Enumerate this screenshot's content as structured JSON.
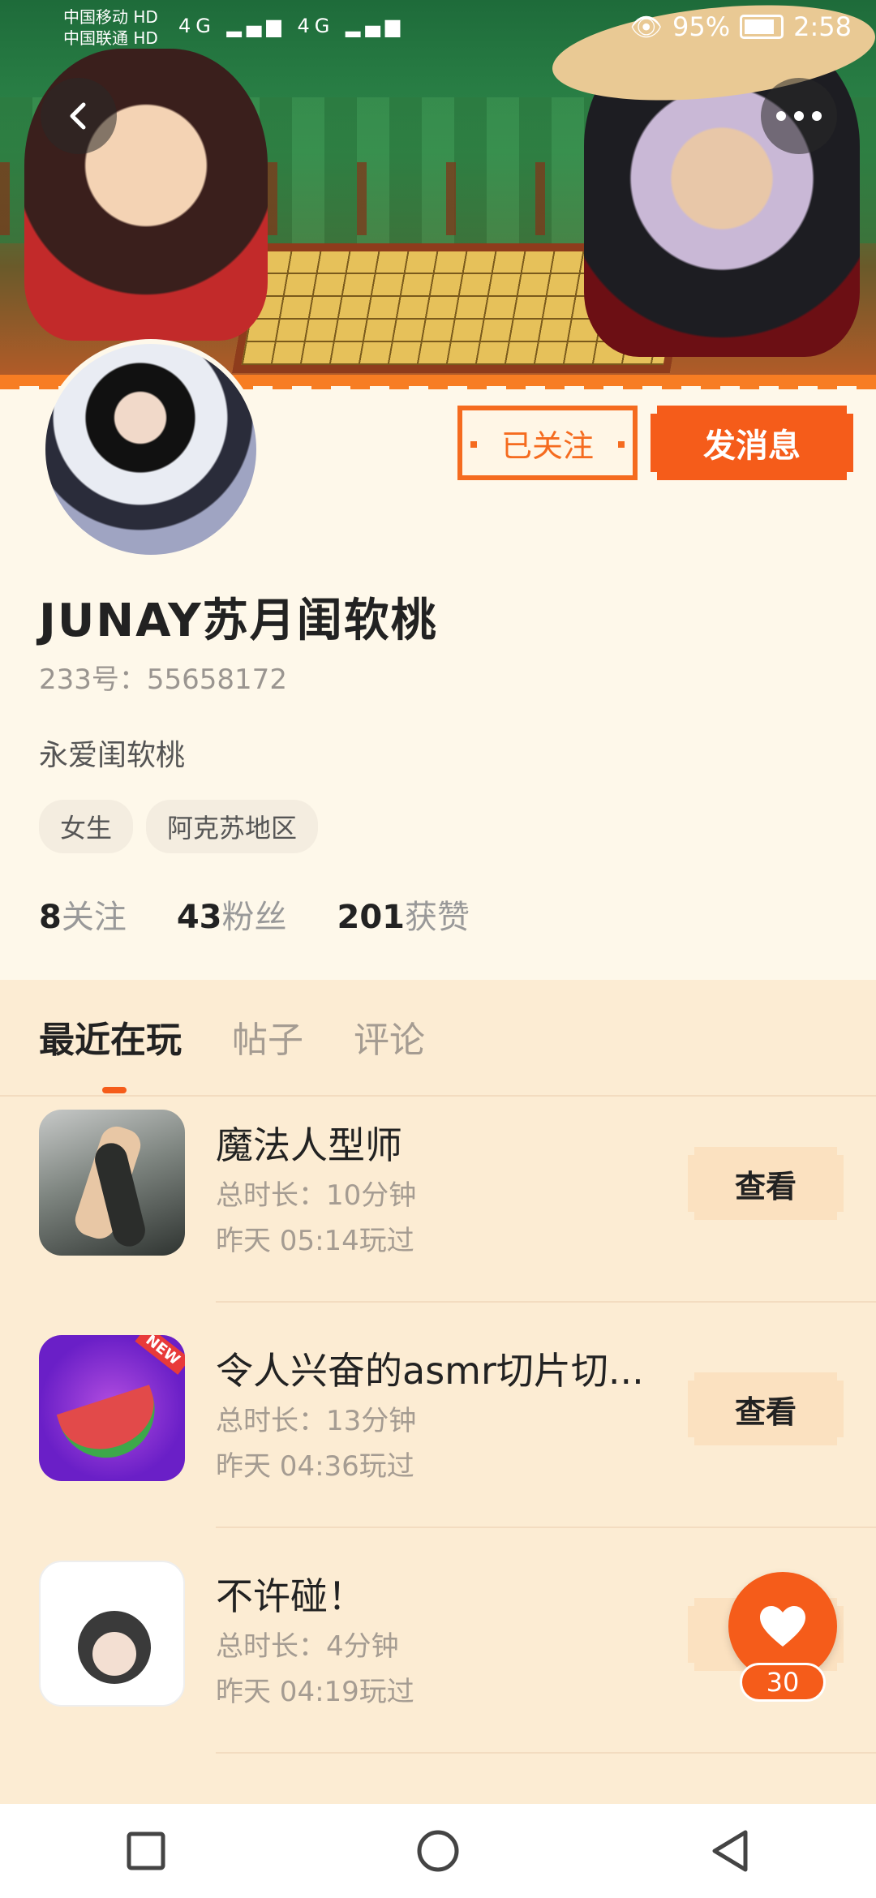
{
  "status_bar": {
    "carrier1": "中国移动",
    "carrier1_badge": "HD",
    "carrier2": "中国联通",
    "carrier2_badge": "HD",
    "network": "4G",
    "battery": "95%",
    "time": "2:58"
  },
  "header": {
    "back_icon": "chevron-left-icon",
    "more_icon": "more-horizontal-icon"
  },
  "profile": {
    "followed_label": "已关注",
    "message_label": "发消息",
    "username": "JUNAY苏月闺软桃",
    "uid": "233号：55658172",
    "bio": "永爱闺软桃",
    "tags": [
      "女生",
      "阿克苏地区"
    ],
    "stats": {
      "following_count": "8",
      "following_label": "关注",
      "fans_count": "43",
      "fans_label": "粉丝",
      "likes_count": "201",
      "likes_label": "获赞"
    }
  },
  "tabs": [
    {
      "label": "最近在玩",
      "active": true
    },
    {
      "label": "帖子",
      "active": false
    },
    {
      "label": "评论",
      "active": false
    }
  ],
  "games": [
    {
      "title": "魔法人型师",
      "duration": "总时长：10分钟",
      "last_played": "昨天 05:14玩过",
      "action": "查看"
    },
    {
      "title": "令人兴奋的asmr切片切...",
      "duration": "总时长：13分钟",
      "last_played": "昨天 04:36玩过",
      "action": "查看"
    },
    {
      "title": "不许碰！",
      "duration": "总时长：4分钟",
      "last_played": "昨天 04:19玩过",
      "action": "查看"
    }
  ],
  "fab": {
    "icon": "heart-icon",
    "count": "30"
  },
  "colors": {
    "accent": "#f55c1a",
    "background": "#fef8ea",
    "list_background": "#fcecd3"
  }
}
